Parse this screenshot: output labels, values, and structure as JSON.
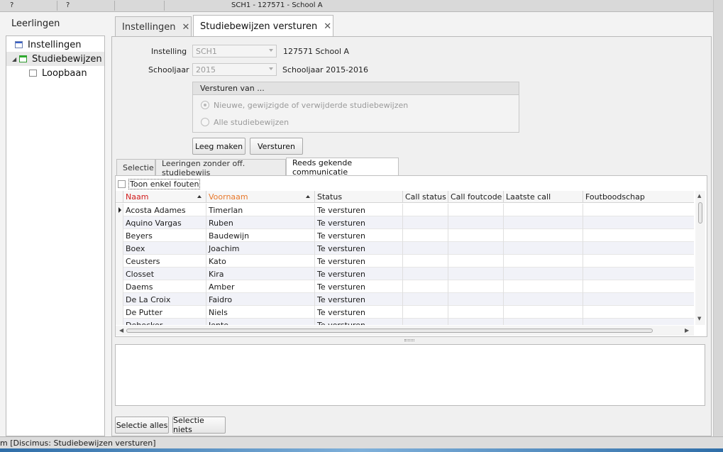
{
  "window": {
    "menu_left": "?",
    "menu_right": "?",
    "title": "SCH1 - 127571 - School A"
  },
  "sidebar": {
    "title": "Leerlingen",
    "items": [
      {
        "label": "Instellingen",
        "icon": "form-icon"
      },
      {
        "label": "Studiebewijzen",
        "icon": "form-icon",
        "selected": true,
        "expanded": true
      },
      {
        "label": "Loopbaan",
        "icon": "form-icon"
      }
    ]
  },
  "tabs": [
    {
      "label": "Instellingen",
      "close": "✕"
    },
    {
      "label": "Studiebewijzen versturen",
      "close": "✕",
      "active": true
    }
  ],
  "form": {
    "instelling_label": "Instelling",
    "instelling_value": "SCH1",
    "instelling_desc": "127571  School A",
    "schooljaar_label": "Schooljaar",
    "schooljaar_value": "2015",
    "schooljaar_desc": "Schooljaar 2015-2016",
    "group_title": "Versturen van ...",
    "radio1": "Nieuwe, gewijzigde of verwijderde studiebewijzen",
    "radio2": "Alle studiebewijzen",
    "selected_radio": 1,
    "clear_button": "Leeg maken",
    "send_button": "Versturen"
  },
  "subtabs": [
    {
      "label": "Selectie"
    },
    {
      "label": "Leeringen zonder off. studiebewijs"
    },
    {
      "label": "Reeds gekende communicatie",
      "active": true
    }
  ],
  "grid": {
    "filter_label": "Toon enkel fouten",
    "columns": [
      "Naam",
      "Voornaam",
      "Status",
      "Call status",
      "Call foutcode",
      "Laatste call",
      "Foutboodschap"
    ],
    "rows": [
      [
        "Acosta Adames",
        "Timerlan",
        "Te versturen"
      ],
      [
        "Aquino Vargas",
        "Ruben",
        "Te versturen"
      ],
      [
        "Beyers",
        "Baudewijn",
        "Te versturen"
      ],
      [
        "Boex",
        "Joachim",
        "Te versturen"
      ],
      [
        "Ceusters",
        "Kato",
        "Te versturen"
      ],
      [
        "Closset",
        "Kira",
        "Te versturen"
      ],
      [
        "Daems",
        "Amber",
        "Te versturen"
      ],
      [
        "De La Croix",
        "Faidro",
        "Te versturen"
      ],
      [
        "De Putter",
        "Niels",
        "Te versturen"
      ],
      [
        "Dehecker",
        "Jente",
        "Te versturen"
      ]
    ],
    "header_colors": {
      "naam": "#d11b1b",
      "voornaam": "#e8782a"
    }
  },
  "footer": {
    "select_all": "Selectie alles",
    "select_none": "Selectie niets"
  },
  "status": {
    "text": "m [Discimus: Studiebewijzen versturen]"
  }
}
